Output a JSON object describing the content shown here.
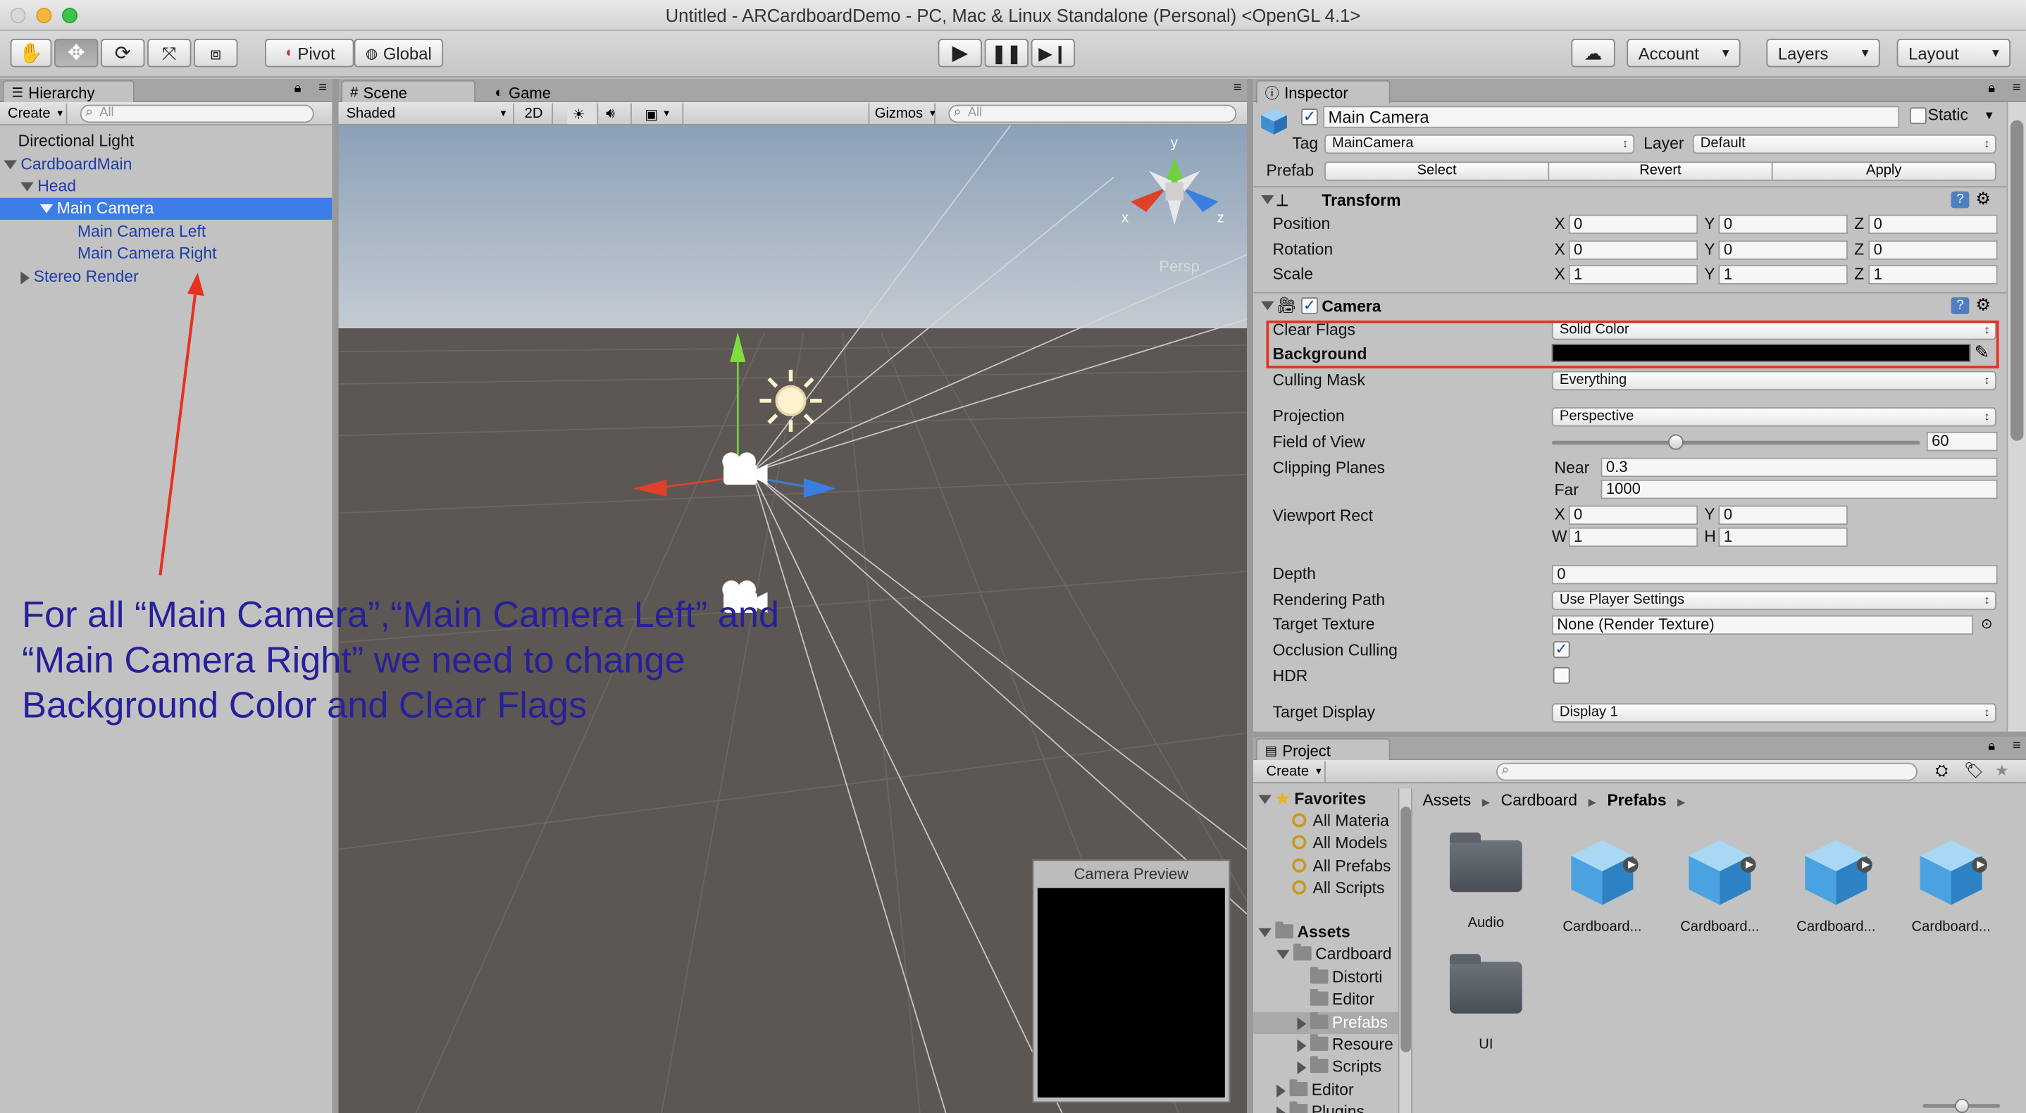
{
  "window": {
    "title": "Untitled - ARCardboardDemo - PC, Mac & Linux Standalone (Personal) <OpenGL 4.1>"
  },
  "toolbar": {
    "tools": [
      "hand-tool",
      "move-tool",
      "rotate-tool",
      "scale-tool",
      "rect-tool"
    ],
    "pivot_label": "Pivot",
    "global_label": "Global",
    "account_label": "Account",
    "layers_label": "Layers",
    "layout_label": "Layout"
  },
  "hierarchy": {
    "tab_label": "Hierarchy",
    "create_label": "Create",
    "search_placeholder": "All",
    "items": [
      {
        "label": "Directional Light"
      },
      {
        "label": "CardboardMain"
      },
      {
        "label": "Head"
      },
      {
        "label": "Main Camera"
      },
      {
        "label": "Main Camera Left"
      },
      {
        "label": "Main Camera Right"
      },
      {
        "label": "Stereo Render"
      }
    ]
  },
  "scene": {
    "tab_scene": "Scene",
    "tab_game": "Game",
    "shading_mode": "Shaded",
    "mode_2d": "2D",
    "gizmos_label": "Gizmos",
    "search_placeholder": "All",
    "axis_x": "x",
    "axis_y": "y",
    "axis_z": "z",
    "persp_label": "Persp",
    "camera_preview_title": "Camera Preview",
    "colors": {
      "sky": "#8a9fb5",
      "ground": "#5d5753"
    }
  },
  "annotation": {
    "text": "For all “Main Camera”,“Main Camera Left” and “Main Camera Right” we need to change Background Color and Clear Flags",
    "color": "#27209a",
    "arrow_color": "#e8301e"
  },
  "inspector": {
    "tab_label": "Inspector",
    "object_name": "Main Camera",
    "static_label": "Static",
    "tag_label": "Tag",
    "tag_value": "MainCamera",
    "layer_label": "Layer",
    "layer_value": "Default",
    "prefab_label": "Prefab",
    "prefab_select": "Select",
    "prefab_revert": "Revert",
    "prefab_apply": "Apply",
    "transform": {
      "title": "Transform",
      "position_label": "Position",
      "rotation_label": "Rotation",
      "scale_label": "Scale",
      "x": "X",
      "y": "Y",
      "z": "Z",
      "position": [
        "0",
        "0",
        "0"
      ],
      "rotation": [
        "0",
        "0",
        "0"
      ],
      "scale": [
        "1",
        "1",
        "1"
      ]
    },
    "camera": {
      "title": "Camera",
      "clear_flags_label": "Clear Flags",
      "clear_flags_value": "Solid Color",
      "background_label": "Background",
      "background_color": "#000000",
      "culling_mask_label": "Culling Mask",
      "culling_mask_value": "Everything",
      "projection_label": "Projection",
      "projection_value": "Perspective",
      "fov_label": "Field of View",
      "fov_value": "60",
      "clipping_label": "Clipping Planes",
      "near_label": "Near",
      "near_value": "0.3",
      "far_label": "Far",
      "far_value": "1000",
      "viewport_label": "Viewport Rect",
      "vp_x_label": "X",
      "vp_x": "0",
      "vp_y_label": "Y",
      "vp_y": "0",
      "vp_w_label": "W",
      "vp_w": "1",
      "vp_h_label": "H",
      "vp_h": "1",
      "depth_label": "Depth",
      "depth_value": "0",
      "rendering_path_label": "Rendering Path",
      "rendering_path_value": "Use Player Settings",
      "target_texture_label": "Target Texture",
      "target_texture_value": "None (Render Texture)",
      "occlusion_label": "Occlusion Culling",
      "occlusion_checked": "✓",
      "hdr_label": "HDR",
      "target_display_label": "Target Display",
      "target_display_value": "Display 1"
    },
    "highlight_color": "#e8301e"
  },
  "project": {
    "tab_label": "Project",
    "create_label": "Create",
    "favorites_label": "Favorites",
    "favorites": [
      "All Materia",
      "All Models",
      "All Prefabs",
      "All Scripts"
    ],
    "assets_label": "Assets",
    "tree": [
      {
        "label": "Cardboard"
      },
      {
        "label": "Distorti"
      },
      {
        "label": "Editor"
      },
      {
        "label": "Prefabs"
      },
      {
        "label": "Resoure"
      },
      {
        "label": "Scripts"
      },
      {
        "label": "Editor"
      },
      {
        "label": "Plugins"
      }
    ],
    "breadcrumb": [
      "Assets",
      "Cardboard",
      "Prefabs"
    ],
    "grid": [
      {
        "label": "Audio",
        "kind": "folder"
      },
      {
        "label": "Cardboard...",
        "kind": "prefab"
      },
      {
        "label": "Cardboard...",
        "kind": "prefab"
      },
      {
        "label": "Cardboard...",
        "kind": "prefab"
      },
      {
        "label": "Cardboard...",
        "kind": "prefab"
      },
      {
        "label": "UI",
        "kind": "folder"
      }
    ]
  }
}
